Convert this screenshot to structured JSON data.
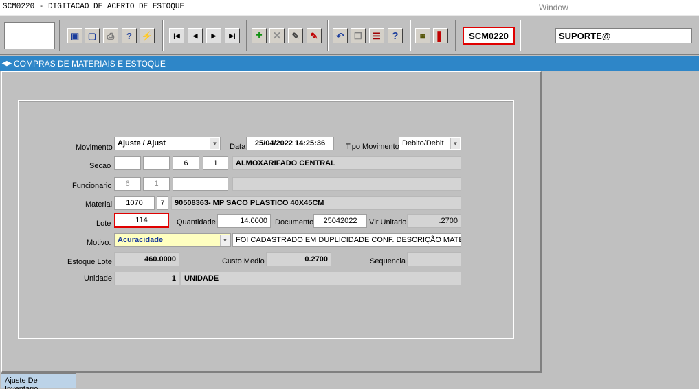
{
  "window": {
    "title": "SCM0220 - DIGITACAO DE ACERTO DE ESTOQUE",
    "menu_window": "Window"
  },
  "toolbar": {
    "screen_code": "SCM0220",
    "user": "SUPORTE@",
    "buttons": [
      "save-icon",
      "window-icon",
      "print-icon",
      "query-help-icon",
      "query-run-icon",
      "first-record-icon",
      "prev-record-icon",
      "next-record-icon",
      "last-record-icon",
      "insert-record-icon",
      "delete-record-icon",
      "edit-icon",
      "clear-icon",
      "undo-icon",
      "copy-icon",
      "list-values-icon",
      "help-icon",
      "menu-icon",
      "exit-icon"
    ]
  },
  "header": {
    "title": "COMPRAS DE MATERIAIS E ESTOQUE"
  },
  "form": {
    "movimento": {
      "label": "Movimento",
      "value": "Ajuste / Ajust"
    },
    "data": {
      "label": "Data",
      "value": "25/04/2022 14:25:36"
    },
    "tipo_movimento": {
      "label": "Tipo Movimento",
      "value": "Debito/Debit"
    },
    "secao": {
      "label": "Secao",
      "v1": "",
      "v2": "",
      "v3": "6",
      "v4": "1",
      "desc": "ALMOXARIFADO CENTRAL"
    },
    "funcionario": {
      "label": "Funcionario",
      "v1": "6",
      "v2": "1",
      "v3": "",
      "desc": ""
    },
    "material": {
      "label": "Material",
      "code": "1070",
      "digit": "7",
      "desc": "90508363- MP SACO PLASTICO 40X45CM"
    },
    "lote": {
      "label": "Lote",
      "value": "114"
    },
    "quantidade": {
      "label": "Quantidade",
      "value": "14.0000"
    },
    "documento": {
      "label": "Documento",
      "value": "25042022"
    },
    "vlr_unitario": {
      "label": "Vlr Unitario",
      "value": ".2700"
    },
    "motivo": {
      "label": "Motivo.",
      "value": "Acuracidade",
      "desc": "FOI CADASTRADO EM DUPLICIDADE CONF. DESCRIÇÃO MATERIAL"
    },
    "estoque_lote": {
      "label": "Estoque Lote",
      "value": "460.0000"
    },
    "custo_medio": {
      "label": "Custo Medio",
      "value": "0.2700"
    },
    "sequencia": {
      "label": "Sequencia",
      "value": ""
    },
    "unidade": {
      "label": "Unidade",
      "value": "1",
      "desc": "UNIDADE"
    }
  },
  "tabs": [
    {
      "label": "Ajuste De Inventario"
    }
  ]
}
